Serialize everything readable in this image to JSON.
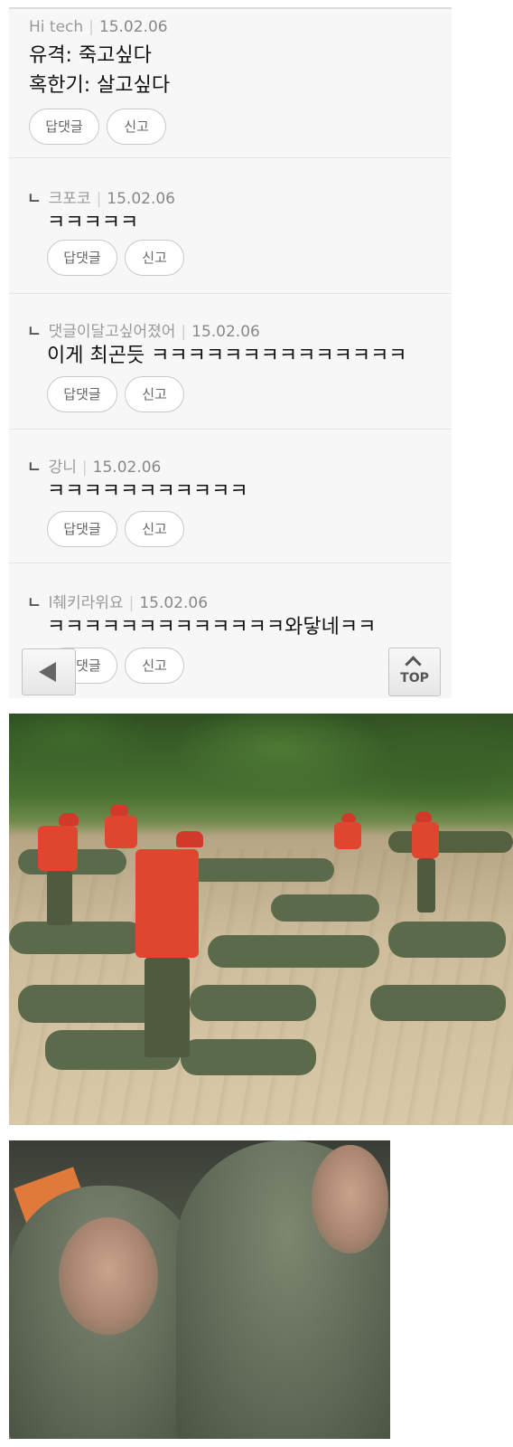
{
  "comments": [
    {
      "reply_mark": "",
      "author": "Hi tech",
      "date": "15.02.06",
      "text_lines": [
        "유격: 죽고싶다",
        "혹한기: 살고싶다"
      ],
      "reply_label": "답댓글",
      "report_label": "신고"
    },
    {
      "reply_mark": "ㄴ",
      "author": "크포코",
      "date": "15.02.06",
      "text_lines": [
        "ㅋㅋㅋㅋㅋ"
      ],
      "reply_label": "답댓글",
      "report_label": "신고"
    },
    {
      "reply_mark": "ㄴ",
      "author": "댓글이달고싶어졌어",
      "date": "15.02.06",
      "text_lines": [
        "이게 최곤듯 ㅋㅋㅋㅋㅋㅋㅋㅋㅋㅋㅋㅋㅋㅋ"
      ],
      "reply_label": "답댓글",
      "report_label": "신고"
    },
    {
      "reply_mark": "ㄴ",
      "author": "강니",
      "date": "15.02.06",
      "text_lines": [
        "ㅋㅋㅋㅋㅋㅋㅋㅋㅋㅋㅋ"
      ],
      "reply_label": "답댓글",
      "report_label": "신고"
    },
    {
      "reply_mark": "ㄴ",
      "author": "l췌키라위요",
      "date": "15.02.06",
      "text_lines": [
        "ㅋㅋㅋㅋㅋㅋㅋㅋㅋㅋㅋㅋㅋ와닿네ㅋㅋ"
      ],
      "reply_label": "답댓글",
      "report_label": "신고"
    }
  ],
  "nav": {
    "back_icon": "back-arrow-icon",
    "top_icon": "chevron-up-icon",
    "top_label": "TOP"
  },
  "images": [
    {
      "name": "training-field-photo"
    },
    {
      "name": "sleeping-bag-photo"
    }
  ]
}
